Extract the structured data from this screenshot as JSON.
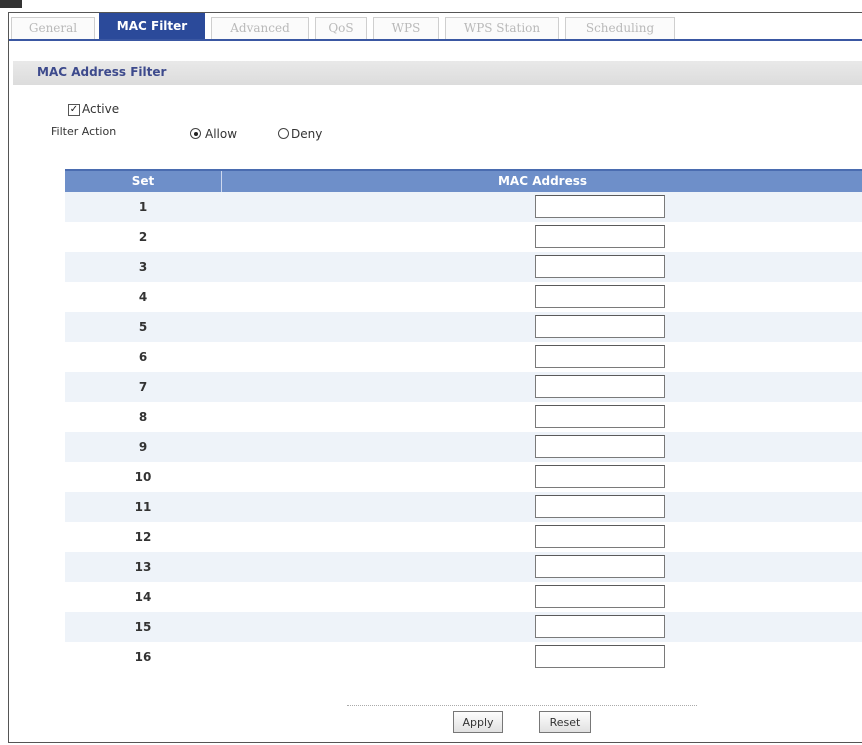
{
  "tabs": [
    {
      "label": "General",
      "active": false
    },
    {
      "label": "MAC Filter",
      "active": true
    },
    {
      "label": "Advanced",
      "active": false
    },
    {
      "label": "QoS",
      "active": false
    },
    {
      "label": "WPS",
      "active": false
    },
    {
      "label": "WPS Station",
      "active": false
    },
    {
      "label": "Scheduling",
      "active": false
    }
  ],
  "section": {
    "title": "MAC Address Filter"
  },
  "active_option": {
    "label": "Active",
    "checked": true
  },
  "filter_action": {
    "label": "Filter Action",
    "options": [
      {
        "label": "Allow",
        "selected": true
      },
      {
        "label": "Deny",
        "selected": false
      }
    ]
  },
  "table": {
    "headers": {
      "set": "Set",
      "mac": "MAC Address"
    },
    "rows": [
      {
        "set": "1",
        "mac": ""
      },
      {
        "set": "2",
        "mac": ""
      },
      {
        "set": "3",
        "mac": ""
      },
      {
        "set": "4",
        "mac": ""
      },
      {
        "set": "5",
        "mac": ""
      },
      {
        "set": "6",
        "mac": ""
      },
      {
        "set": "7",
        "mac": ""
      },
      {
        "set": "8",
        "mac": ""
      },
      {
        "set": "9",
        "mac": ""
      },
      {
        "set": "10",
        "mac": ""
      },
      {
        "set": "11",
        "mac": ""
      },
      {
        "set": "12",
        "mac": ""
      },
      {
        "set": "13",
        "mac": ""
      },
      {
        "set": "14",
        "mac": ""
      },
      {
        "set": "15",
        "mac": ""
      },
      {
        "set": "16",
        "mac": ""
      }
    ]
  },
  "buttons": {
    "apply": "Apply",
    "reset": "Reset"
  },
  "colors": {
    "active_tab": "#2b4a9a",
    "table_header": "#6e8fc9",
    "section_title": "#3d4a8c",
    "row_alt": "#eef3f9"
  }
}
